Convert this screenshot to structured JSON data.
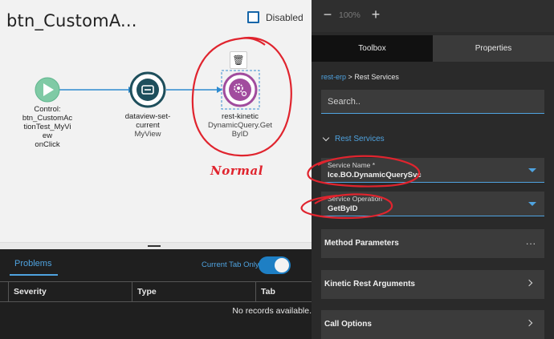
{
  "canvas": {
    "title": "btn_CustomA...",
    "disabled_label": "Disabled",
    "annotation": "Normal",
    "nodes": [
      {
        "lines": [
          "Control:",
          "btn_CustomAc",
          "tionTest_MyVi",
          "ew",
          "onClick"
        ]
      },
      {
        "lines": [
          "dataview-set-",
          "current"
        ],
        "sub": "MyView"
      },
      {
        "lines": [
          "rest-kinetic"
        ],
        "sub_lines": [
          "DynamicQuery.Get",
          "ByID"
        ]
      }
    ],
    "colors": {
      "start": "#7fcaa5",
      "node_border": "#1e4f5c",
      "selected": "#a14c9e",
      "annotation": "#e0242e"
    }
  },
  "problems": {
    "tab": "Problems",
    "current_tab_only": "Current Tab Only",
    "columns": [
      "Severity",
      "Type",
      "Tab"
    ],
    "empty": "No records available."
  },
  "right": {
    "zoom": {
      "minus": "−",
      "value": "100%",
      "plus": "+"
    },
    "tabs": [
      "Toolbox",
      "Properties"
    ],
    "breadcrumb": {
      "link": "rest-erp",
      "sep": ">",
      "current": "Rest Services"
    },
    "search_placeholder": "Search..",
    "section": "Rest Services",
    "service_name": {
      "label": "Service Name *",
      "value": "Ice.BO.DynamicQuerySvc"
    },
    "service_operation": {
      "label": "Service Operation",
      "value": "GetByID"
    },
    "rows": [
      "Method Parameters",
      "Kinetic Rest Arguments",
      "Call Options"
    ],
    "more_icon": "..."
  }
}
